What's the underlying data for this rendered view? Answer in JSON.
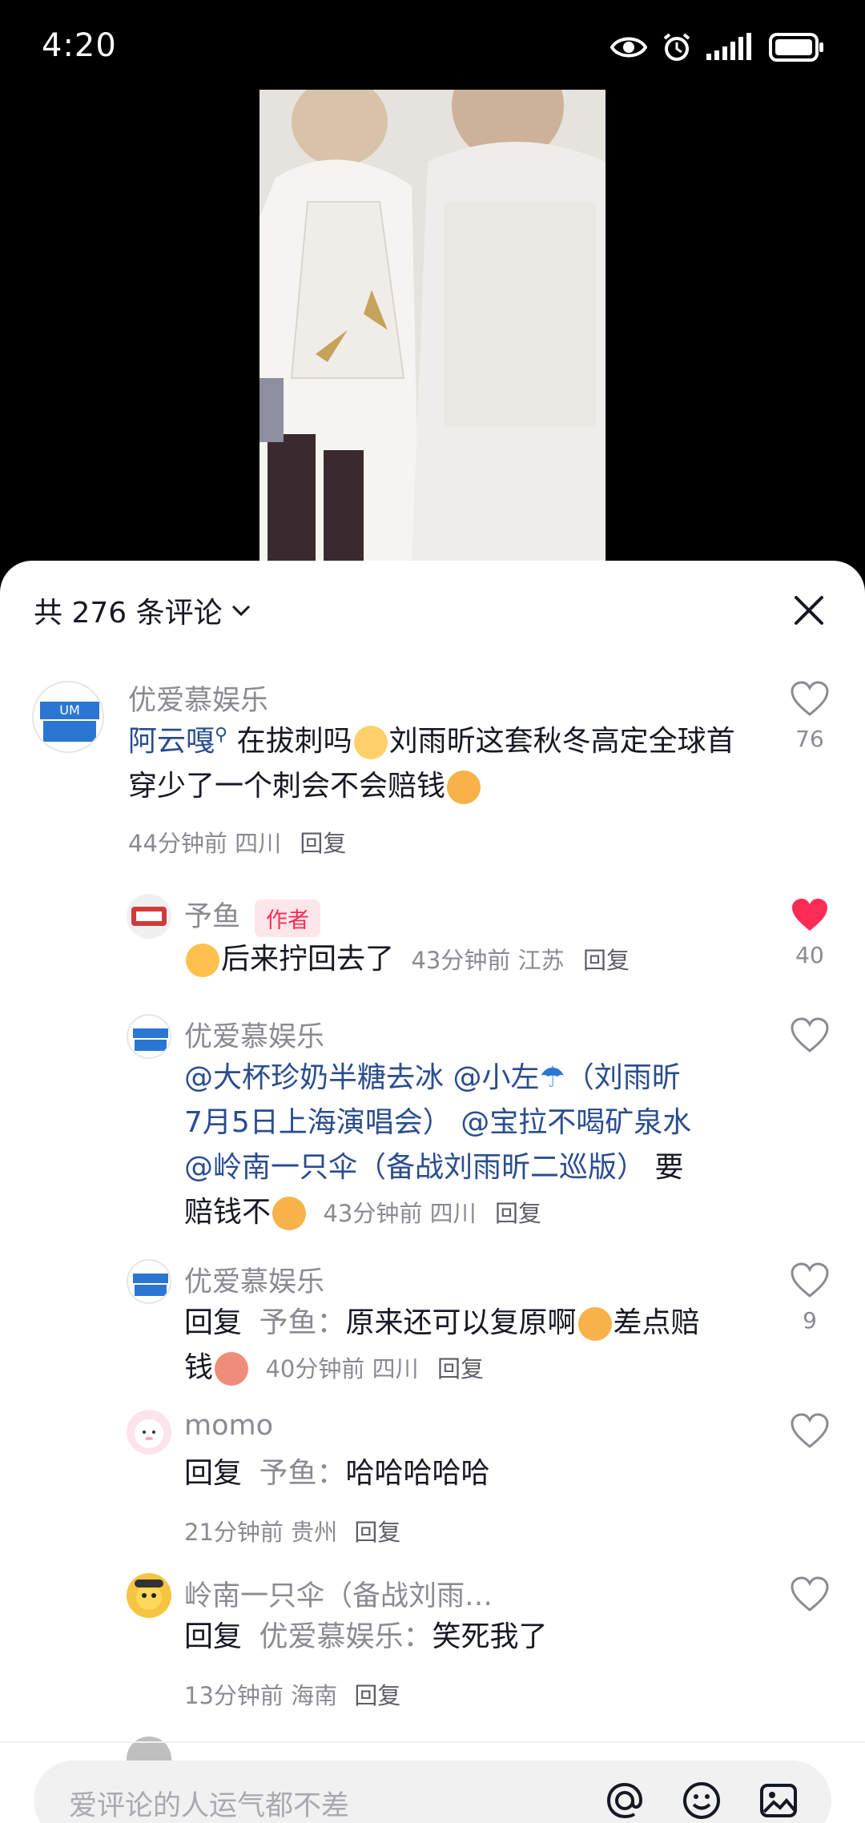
{
  "status": {
    "time": "4:20"
  },
  "header": {
    "count_label": "共 276 条评论"
  },
  "comments": [
    {
      "name": "优爱慕娱乐",
      "mention": "阿云嘎",
      "text": " 在拔刺吗",
      "text2": "刘雨昕这套秋冬高定全球首穿少了一个刺会不会赔钱",
      "meta": "44分钟前 四川",
      "reply": "回复",
      "likes": "76",
      "avatar_text": "优爱慕娱乐"
    },
    {
      "name": "予鱼",
      "badge": "作者",
      "text": "后来拧回去了",
      "meta": "43分钟前 江苏",
      "reply": "回复",
      "likes": "40"
    },
    {
      "name": "优爱慕娱乐",
      "line1": "@大杯珍奶半糖去冰 @小左",
      "line1b": "（刘雨昕",
      "line2": "7月5日上海演唱会） @宝拉不喝矿泉水",
      "line3": "@岭南一只伞（备战刘雨昕二巡版）",
      "line3b": " 要",
      "line4": "赔钱不",
      "meta": "43分钟前 四川",
      "reply": "回复"
    },
    {
      "name": "优爱慕娱乐",
      "reply_prefix": "回复",
      "reply_to": "予鱼：",
      "text": "原来还可以复原啊",
      "text2": "差点赔",
      "text3": "钱",
      "meta": "40分钟前 四川",
      "reply": "回复",
      "likes": "9"
    },
    {
      "name": "momo",
      "reply_prefix": "回复",
      "reply_to": "予鱼：",
      "text": "哈哈哈哈哈",
      "meta": "21分钟前 贵州",
      "reply": "回复"
    },
    {
      "name": "岭南一只伞（备战刘雨…",
      "reply_prefix": "回复",
      "reply_to": "优爱慕娱乐：",
      "text": "笑死我了",
      "meta": "13分钟前 海南",
      "reply": "回复"
    }
  ],
  "input": {
    "placeholder": "爱评论的人运气都不差"
  },
  "colors": {
    "like_active": "#fe2c55",
    "mention": "#2a4d8f"
  }
}
